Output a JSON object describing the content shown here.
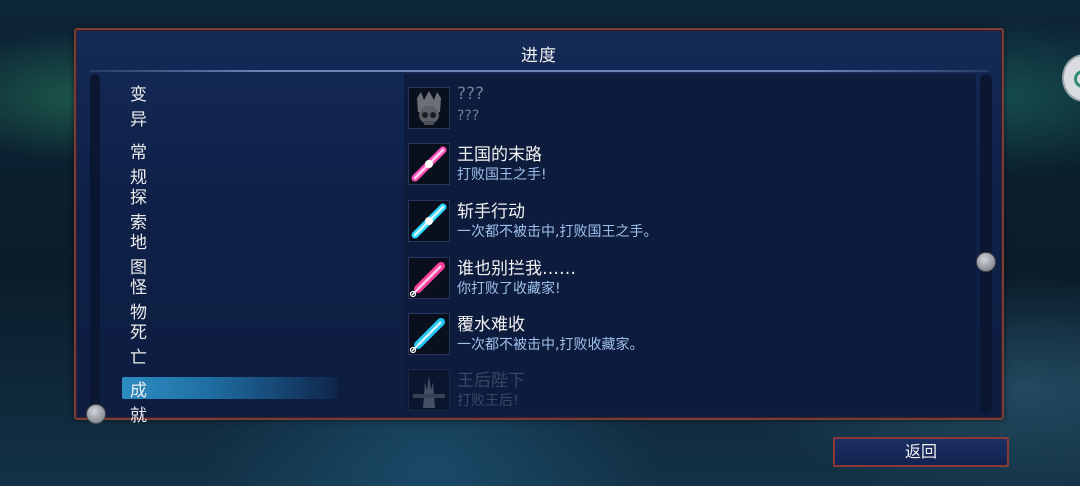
{
  "panel": {
    "title": "进度"
  },
  "categories": [
    "变异",
    "常规",
    "探索",
    "地图",
    "怪物",
    "死亡",
    "成就"
  ],
  "selected_category": "成就",
  "achievements": [
    {
      "name": "???",
      "desc": "???",
      "icon": "crowned-skull-icon",
      "state": "locked"
    },
    {
      "name": "王国的末路",
      "desc": "打败国王之手!",
      "icon": "pink-blade-icon",
      "state": "unlocked"
    },
    {
      "name": "斩手行动",
      "desc": "一次都不被击中,打败国王之手。",
      "icon": "cyan-blade-icon",
      "state": "unlocked"
    },
    {
      "name": "谁也别拦我……",
      "desc": "你打败了收藏家!",
      "icon": "pink-syringe-icon",
      "state": "unlocked"
    },
    {
      "name": "覆水难收",
      "desc": "一次都不被击中,打败收藏家。",
      "icon": "cyan-syringe-icon",
      "state": "unlocked"
    },
    {
      "name": "王后陛下",
      "desc": "打败王后!",
      "icon": "queen-silhouette-icon",
      "state": "faded"
    }
  ],
  "back_button": {
    "label": "返回"
  },
  "colors": {
    "panel_border": "#7a3e3a",
    "selected": "#2d8dc2",
    "desc_text": "#9ec0ea"
  }
}
